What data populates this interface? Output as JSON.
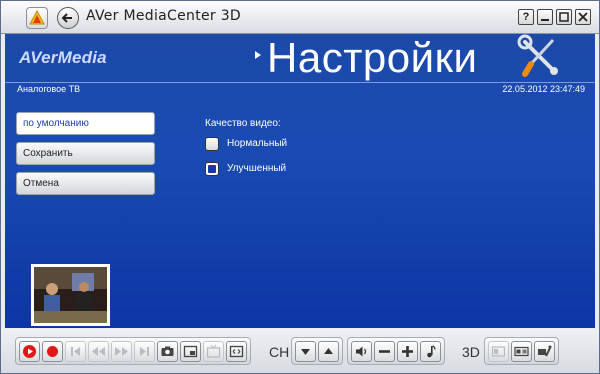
{
  "window": {
    "title": "AVer MediaCenter 3D",
    "help_label": "?"
  },
  "header": {
    "brand": "AVerMedia",
    "page_title": "Настройки",
    "source": "Аналоговое ТВ",
    "datetime": "22.05.2012 23:47:49"
  },
  "sidebar": {
    "items": [
      {
        "label": "по умолчанию",
        "active": true
      },
      {
        "label": "Сохранить",
        "active": false
      },
      {
        "label": "Отмена",
        "active": false
      }
    ]
  },
  "quality": {
    "label": "Качество видео:",
    "options": [
      {
        "label": "Нормальный",
        "checked": false
      },
      {
        "label": "Улучшенный",
        "checked": true
      }
    ]
  },
  "controls": {
    "channel_label": "CH",
    "threed_label": "3D"
  },
  "colors": {
    "accent_blue": "#1a4bb3",
    "record_red": "#e01818"
  }
}
